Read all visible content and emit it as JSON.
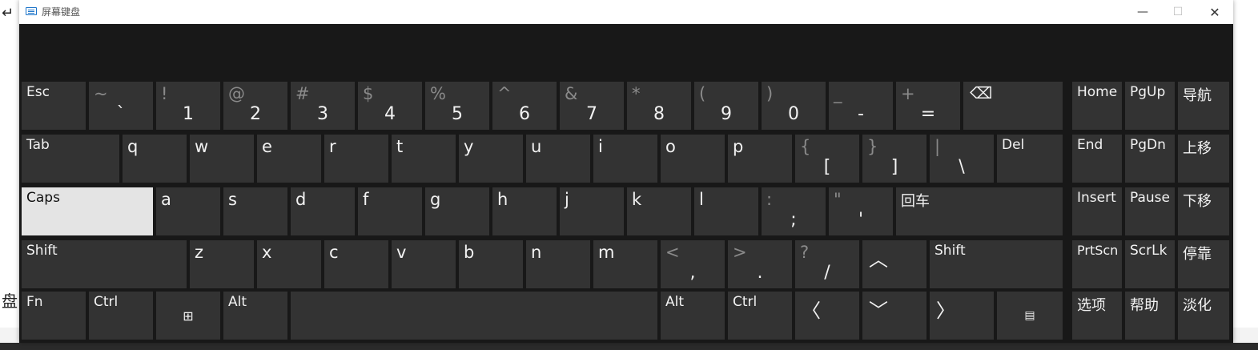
{
  "window": {
    "title": "屏幕键盘",
    "controls": {
      "minimize": "—",
      "maximize": "☐",
      "close": "✕"
    }
  },
  "background": {
    "glyph_top": "↵",
    "glyph_mid": "盘"
  },
  "keys": {
    "esc": "Esc",
    "grave": {
      "sec": "~",
      "pri": "`"
    },
    "d1": {
      "sec": "!",
      "pri": "1"
    },
    "d2": {
      "sec": "@",
      "pri": "2"
    },
    "d3": {
      "sec": "#",
      "pri": "3"
    },
    "d4": {
      "sec": "$",
      "pri": "4"
    },
    "d5": {
      "sec": "%",
      "pri": "5"
    },
    "d6": {
      "sec": "^",
      "pri": "6"
    },
    "d7": {
      "sec": "&",
      "pri": "7"
    },
    "d8": {
      "sec": "*",
      "pri": "8"
    },
    "d9": {
      "sec": "(",
      "pri": "9"
    },
    "d0": {
      "sec": ")",
      "pri": "0"
    },
    "minus": {
      "sec": "_",
      "pri": "-"
    },
    "equals": {
      "sec": "+",
      "pri": "="
    },
    "backspace_icon": "⌫",
    "home": "Home",
    "pgup": "PgUp",
    "nav": "导航",
    "tab": "Tab",
    "q": "q",
    "w": "w",
    "e": "e",
    "r": "r",
    "t": "t",
    "y": "y",
    "u": "u",
    "i": "i",
    "o": "o",
    "p": "p",
    "lbracket": {
      "sec": "{",
      "pri": "["
    },
    "rbracket": {
      "sec": "}",
      "pri": "]"
    },
    "backslash": {
      "sec": "|",
      "pri": "\\"
    },
    "del": "Del",
    "end": "End",
    "pgdn": "PgDn",
    "moveup": "上移",
    "caps": "Caps",
    "a": "a",
    "s": "s",
    "d": "d",
    "f": "f",
    "g": "g",
    "h": "h",
    "j": "j",
    "k": "k",
    "l": "l",
    "semicolon": {
      "sec": ":",
      "pri": ";"
    },
    "quote": {
      "sec": "\"",
      "pri": "'"
    },
    "enter": "回车",
    "insert": "Insert",
    "pause": "Pause",
    "movedown": "下移",
    "shift_left": "Shift",
    "z": "z",
    "x": "x",
    "c": "c",
    "v": "v",
    "b": "b",
    "n": "n",
    "m": "m",
    "comma": {
      "sec": "<",
      "pri": ","
    },
    "period": {
      "sec": ">",
      "pri": "."
    },
    "slash": {
      "sec": "?",
      "pri": "/"
    },
    "up_icon": "︿",
    "shift_right": "Shift",
    "prtscn": "PrtScn",
    "scrlk": "ScrLk",
    "dock": "停靠",
    "fn": "Fn",
    "ctrl_left": "Ctrl",
    "win_icon": "⊞",
    "alt_left": "Alt",
    "alt_right": "Alt",
    "ctrl_right": "Ctrl",
    "left_icon": "〈",
    "down_icon": "﹀",
    "right_icon": "〉",
    "menu_icon": "▤",
    "options": "选项",
    "help": "帮助",
    "fade": "淡化"
  }
}
